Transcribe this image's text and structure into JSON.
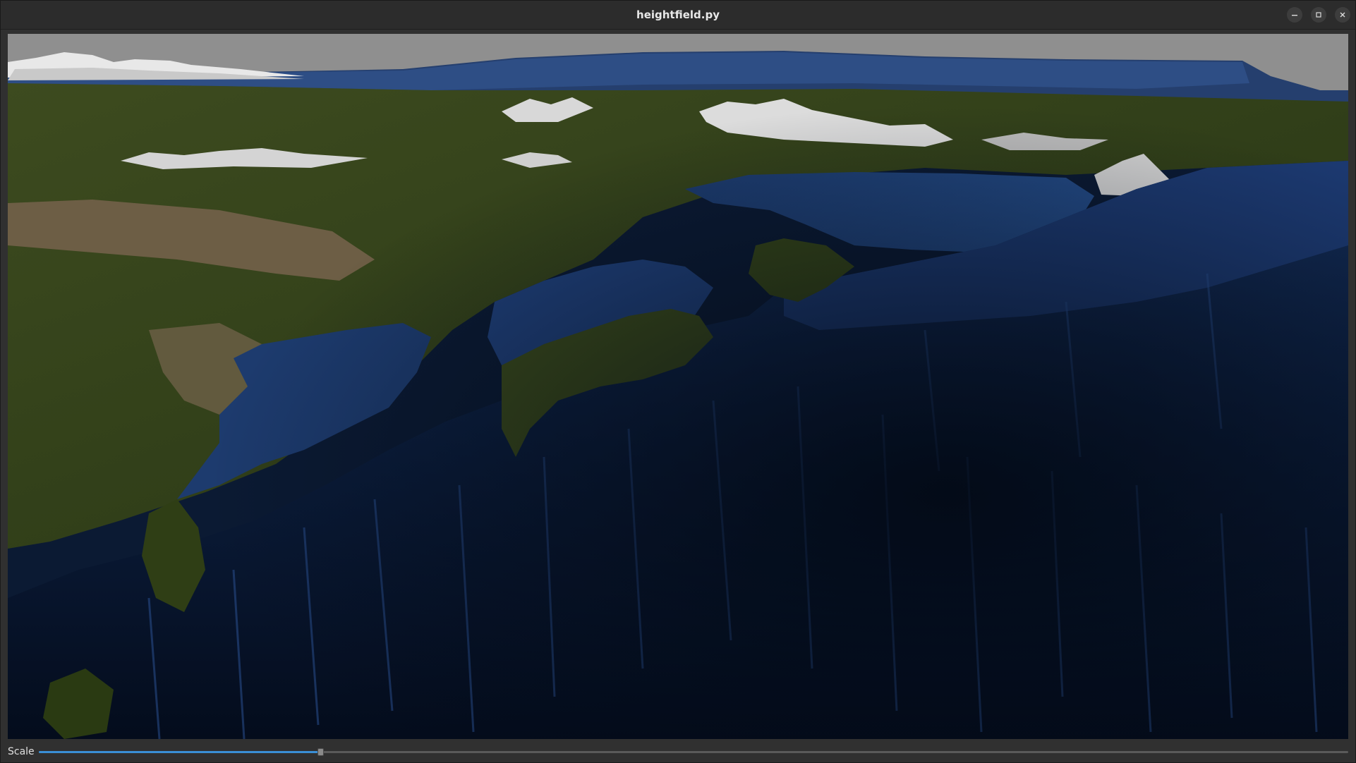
{
  "window": {
    "title": "heightfield.py",
    "controls": {
      "minimize_icon": "minimize-icon",
      "maximize_icon": "maximize-icon",
      "close_icon": "close-icon"
    }
  },
  "viewport": {
    "content": "3D heightfield terrain render",
    "colors": {
      "sky": "#8f8f8f",
      "land": "#3b4a1e",
      "desert": "#7a6a4e",
      "snow": "#e6e6e6",
      "ocean_shallow": "#1e3f75",
      "ocean_deep": "#07152c"
    }
  },
  "controls": {
    "scale_label": "Scale",
    "scale_fraction": 0.215,
    "accent_color": "#3a8fd6"
  }
}
